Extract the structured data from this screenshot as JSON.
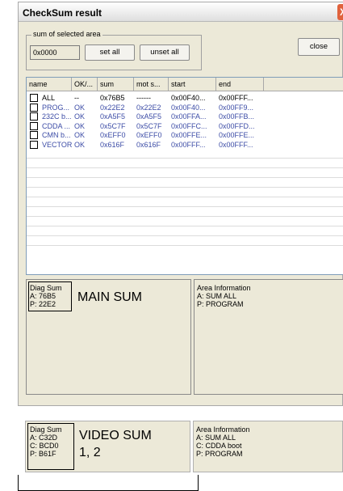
{
  "window": {
    "title": "CheckSum result",
    "close_glyph": "X"
  },
  "selection": {
    "label": "sum of selected area",
    "value": "0x0000",
    "set_all": "set all",
    "unset_all": "unset all"
  },
  "close_label": "close",
  "table": {
    "columns": [
      "name",
      "OK/...",
      "sum",
      "mot s...",
      "start",
      "end"
    ],
    "rows": [
      {
        "name": "ALL",
        "ok": "--",
        "sum": "0x76B5",
        "mot": "------",
        "start": "0x00F40...",
        "end": "0x00FFF...",
        "color": "#000000"
      },
      {
        "name": "PROG...",
        "ok": "OK",
        "sum": "0x22E2",
        "mot": "0x22E2",
        "start": "0x00F40...",
        "end": "0x00FF9...",
        "color": "#3c4ca6"
      },
      {
        "name": "232C b...",
        "ok": "OK",
        "sum": "0xA5F5",
        "mot": "0xA5F5",
        "start": "0x00FFA...",
        "end": "0x00FFB...",
        "color": "#3c4ca6"
      },
      {
        "name": "CDDA ...",
        "ok": "OK",
        "sum": "0x5C7F",
        "mot": "0x5C7F",
        "start": "0x00FFC...",
        "end": "0x00FFD...",
        "color": "#3c4ca6"
      },
      {
        "name": "CMN b...",
        "ok": "OK",
        "sum": "0xEFF0",
        "mot": "0xEFF0",
        "start": "0x00FFE...",
        "end": "0x00FFE...",
        "color": "#3c4ca6"
      },
      {
        "name": "VECTOR",
        "ok": "OK",
        "sum": "0x616F",
        "mot": "0x616F",
        "start": "0x00FFF...",
        "end": "0x00FFF...",
        "color": "#3c4ca6"
      }
    ]
  },
  "diag_main": {
    "lines": [
      "Diag Sum",
      "A: 76B5",
      "P: 22E2"
    ],
    "annotation": "MAIN SUM"
  },
  "area_main": {
    "lines": [
      "Area Information",
      "A: SUM ALL",
      "P: PROGRAM"
    ]
  },
  "diag_video": {
    "lines": [
      "Diag Sum",
      "A: C32D",
      "C: BCD0",
      "P: B61F"
    ],
    "annotation_line1": "VIDEO SUM",
    "annotation_line2": "1, 2"
  },
  "area_video": {
    "lines": [
      "Area Information",
      "A: SUM ALL",
      "C: CDDA boot",
      "P: PROGRAM"
    ]
  }
}
